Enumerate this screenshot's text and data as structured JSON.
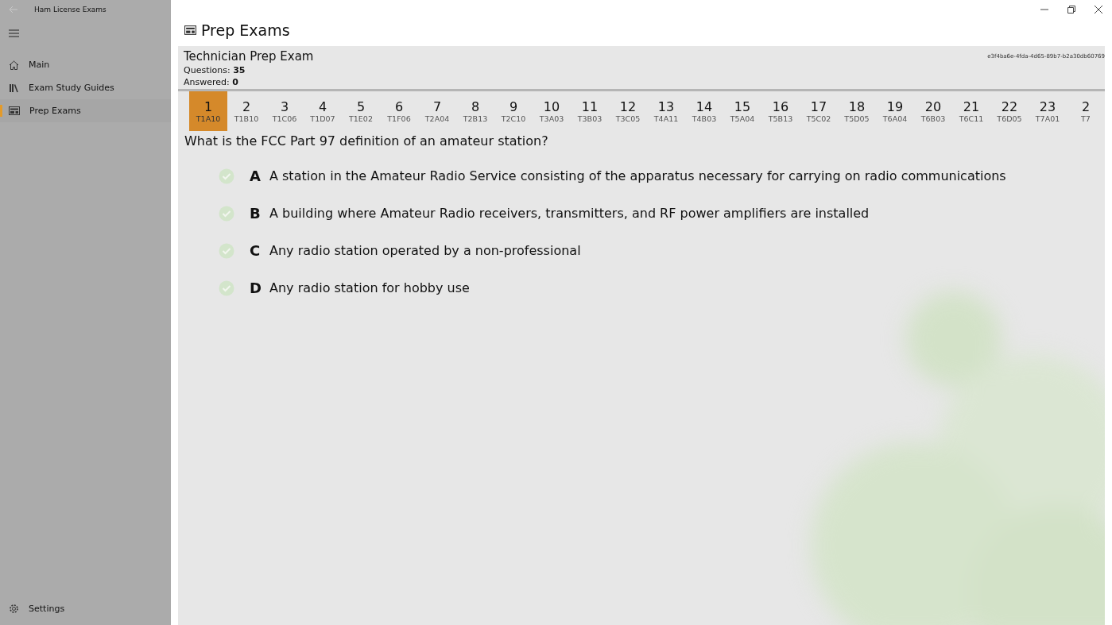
{
  "window": {
    "title": "Ham License Exams"
  },
  "sidebar": {
    "items": [
      {
        "label": "Main",
        "kind": "home",
        "selected": false
      },
      {
        "label": "Exam Study Guides",
        "kind": "books",
        "selected": false
      },
      {
        "label": "Prep Exams",
        "kind": "exam",
        "selected": true
      }
    ],
    "footer": {
      "label": "Settings"
    }
  },
  "page": {
    "title": "Prep Exams"
  },
  "exam": {
    "title": "Technician Prep Exam",
    "id": "e3f4ba6e-4fda-4d65-89b7-b2a30db60769",
    "questions_label": "Questions:",
    "questions": "35",
    "answered_label": "Answered:",
    "answered": "0"
  },
  "questions": [
    {
      "number": "1",
      "code": "T1A10",
      "selected": true
    },
    {
      "number": "2",
      "code": "T1B10",
      "selected": false
    },
    {
      "number": "3",
      "code": "T1C06",
      "selected": false
    },
    {
      "number": "4",
      "code": "T1D07",
      "selected": false
    },
    {
      "number": "5",
      "code": "T1E02",
      "selected": false
    },
    {
      "number": "6",
      "code": "T1F06",
      "selected": false
    },
    {
      "number": "7",
      "code": "T2A04",
      "selected": false
    },
    {
      "number": "8",
      "code": "T2B13",
      "selected": false
    },
    {
      "number": "9",
      "code": "T2C10",
      "selected": false
    },
    {
      "number": "10",
      "code": "T3A03",
      "selected": false
    },
    {
      "number": "11",
      "code": "T3B03",
      "selected": false
    },
    {
      "number": "12",
      "code": "T3C05",
      "selected": false
    },
    {
      "number": "13",
      "code": "T4A11",
      "selected": false
    },
    {
      "number": "14",
      "code": "T4B03",
      "selected": false
    },
    {
      "number": "15",
      "code": "T5A04",
      "selected": false
    },
    {
      "number": "16",
      "code": "T5B13",
      "selected": false
    },
    {
      "number": "17",
      "code": "T5C02",
      "selected": false
    },
    {
      "number": "18",
      "code": "T5D05",
      "selected": false
    },
    {
      "number": "19",
      "code": "T6A04",
      "selected": false
    },
    {
      "number": "20",
      "code": "T6B03",
      "selected": false
    },
    {
      "number": "21",
      "code": "T6C11",
      "selected": false
    },
    {
      "number": "22",
      "code": "T6D05",
      "selected": false
    },
    {
      "number": "23",
      "code": "T7A01",
      "selected": false
    },
    {
      "number": "2",
      "code": "T7",
      "selected": false
    }
  ],
  "question": "What is the FCC Part 97 definition of an amateur station?",
  "answers": [
    {
      "letter": "A",
      "text": "A station in the Amateur Radio Service consisting of the apparatus necessary for carrying on radio communications"
    },
    {
      "letter": "B",
      "text": "A building where Amateur Radio receivers, transmitters, and RF power amplifiers are installed"
    },
    {
      "letter": "C",
      "text": "Any radio station operated by a non-professional"
    },
    {
      "letter": "D",
      "text": "Any radio station for hobby use"
    }
  ]
}
